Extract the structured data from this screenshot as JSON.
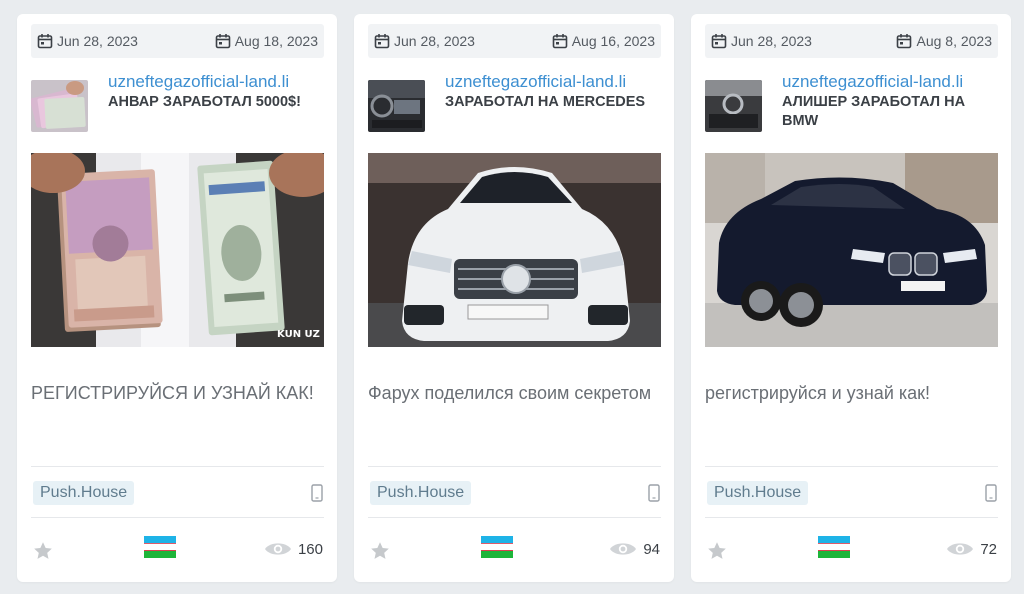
{
  "cards": [
    {
      "date_start": "Jun 28, 2023",
      "date_end": "Aug 18, 2023",
      "domain": "uzneftegazofficial-land.li",
      "title": "АНВАР ЗАРАБОТАЛ 5000$!",
      "description": "РЕГИСТРИРУЙСЯ И УЗНАЙ КАК!",
      "network": "Push.House",
      "views": "160",
      "image_icon": "money-image",
      "watermark": "KUN UZ"
    },
    {
      "date_start": "Jun 28, 2023",
      "date_end": "Aug 16, 2023",
      "domain": "uzneftegazofficial-land.li",
      "title": "ЗАРАБОТАЛ НА MERCEDES",
      "description": "Фарух поделился своим секретом",
      "network": "Push.House",
      "views": "94",
      "image_icon": "mercedes-image"
    },
    {
      "date_start": "Jun 28, 2023",
      "date_end": "Aug 8, 2023",
      "domain": "uzneftegazofficial-land.li",
      "title": "АЛИШЕР ЗАРАБОТАЛ НА BMW",
      "description": "регистрируйся и узнай как!",
      "network": "Push.House",
      "views": "72",
      "image_icon": "bmw-image"
    }
  ],
  "colors": {
    "domain": "#3d8fd1",
    "badge_bg": "#e7f1f6",
    "badge_text": "#607c8e",
    "flag_blue": "#1eb3e7",
    "flag_white": "#ffffff",
    "flag_green": "#1eb53a",
    "flag_red": "#ce1126"
  }
}
